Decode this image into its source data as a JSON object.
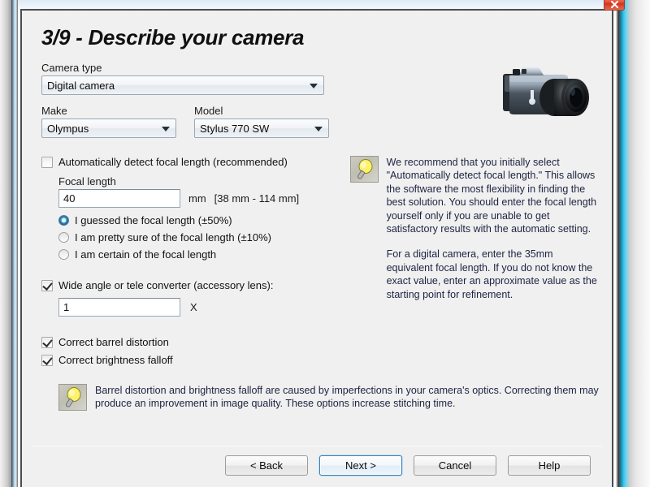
{
  "window": {
    "close_label": "Close"
  },
  "dialog": {
    "title": "3/9 - Describe your camera",
    "camera_type": {
      "label": "Camera type",
      "value": "Digital camera"
    },
    "make": {
      "label": "Make",
      "value": "Olympus"
    },
    "model": {
      "label": "Model",
      "value": "Stylus 770 SW"
    },
    "auto_focal": {
      "label": "Automatically detect focal length (recommended)",
      "checked": false
    },
    "focal_length": {
      "label": "Focal length",
      "value": "40",
      "unit": "mm",
      "range": "[38 mm - 114 mm]"
    },
    "confidence_options": [
      {
        "label": "I guessed the focal length (±50%)",
        "selected": true
      },
      {
        "label": "I am pretty sure of the focal length (±10%)",
        "selected": false
      },
      {
        "label": "I am certain of the focal length",
        "selected": false
      }
    ],
    "converter": {
      "label": "Wide angle or tele converter (accessory lens):",
      "checked": true,
      "value": "1",
      "unit": "X"
    },
    "barrel_distortion": {
      "label": "Correct barrel distortion",
      "checked": true
    },
    "brightness_falloff": {
      "label": "Correct brightness falloff",
      "checked": true
    },
    "help_right": {
      "paragraph1": "We recommend that you initially select \"Automatically detect focal length.\"  This allows the software the most flexibility in finding the best solution.  You should enter the focal length yourself only if you are unable to get satisfactory results with the automatic setting.",
      "paragraph2": "For a digital camera, enter the 35mm equivalent focal length.  If you do not know the exact value, enter an approximate value as the starting point for refinement."
    },
    "help_bottom": {
      "text": "Barrel distortion and brightness falloff are caused by imperfections in your camera's optics.  Correcting them may produce an improvement in image quality.  These options increase stitching time."
    },
    "buttons": {
      "back": "< Back",
      "next": "Next >",
      "cancel": "Cancel",
      "help": "Help"
    }
  },
  "colors": {
    "dialog_bg": "#f0f0f0",
    "help_text": "#1d2340",
    "accent_blue": "#3c7fb1",
    "close_red": "#cf3520"
  }
}
